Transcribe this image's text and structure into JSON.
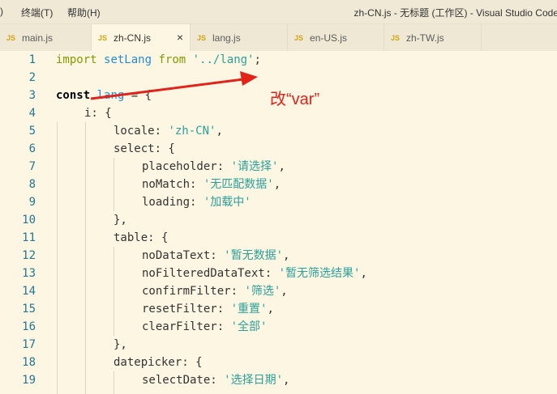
{
  "menu": {
    "item_view": ")",
    "item_terminal": "终端(T)",
    "item_help": "帮助(H)"
  },
  "window_title": "zh-CN.js - 无标题 (工作区) - Visual Studio Code",
  "tabs": [
    {
      "icon": "JS",
      "label": "main.js",
      "active": false
    },
    {
      "icon": "JS",
      "label": "zh-CN.js",
      "active": true,
      "close": "×"
    },
    {
      "icon": "JS",
      "label": "lang.js",
      "active": false
    },
    {
      "icon": "JS",
      "label": "en-US.js",
      "active": false
    },
    {
      "icon": "JS",
      "label": "zh-TW.js",
      "active": false
    }
  ],
  "line_numbers": [
    "1",
    "2",
    "3",
    "4",
    "5",
    "6",
    "7",
    "8",
    "9",
    "10",
    "11",
    "12",
    "13",
    "14",
    "15",
    "16",
    "17",
    "18",
    "19"
  ],
  "code": {
    "l1": {
      "import": "import",
      "name": "setLang",
      "from": "from",
      "path": "'../lang'",
      "semi": ";"
    },
    "l3": {
      "const": "const",
      "name": "lang",
      "rest": " = {"
    },
    "l4": "i: {",
    "l5": {
      "key": "locale: ",
      "val": "'zh-CN'",
      "rest": ","
    },
    "l6": "select: {",
    "l7": {
      "key": "placeholder: ",
      "val": "'请选择'",
      "rest": ","
    },
    "l8": {
      "key": "noMatch: ",
      "val": "'无匹配数据'",
      "rest": ","
    },
    "l9": {
      "key": "loading: ",
      "val": "'加载中'",
      "rest": ""
    },
    "l10": "},",
    "l11": "table: {",
    "l12": {
      "key": "noDataText: ",
      "val": "'暂无数据'",
      "rest": ","
    },
    "l13": {
      "key": "noFilteredDataText: ",
      "val": "'暂无筛选结果'",
      "rest": ","
    },
    "l14": {
      "key": "confirmFilter: ",
      "val": "'筛选'",
      "rest": ","
    },
    "l15": {
      "key": "resetFilter: ",
      "val": "'重置'",
      "rest": ","
    },
    "l16": {
      "key": "clearFilter: ",
      "val": "'全部'",
      "rest": ""
    },
    "l17": "},",
    "l18": "datepicker: {",
    "l19": {
      "key": "selectDate: ",
      "val": "'选择日期'",
      "rest": ","
    }
  },
  "annotation": "改“var”",
  "colors": {
    "keyword": "#859900",
    "function": "#268bd2",
    "string": "#2aa198",
    "line_number": "#237893",
    "annotation": "#e2231a",
    "background": "#fdf6e3"
  }
}
